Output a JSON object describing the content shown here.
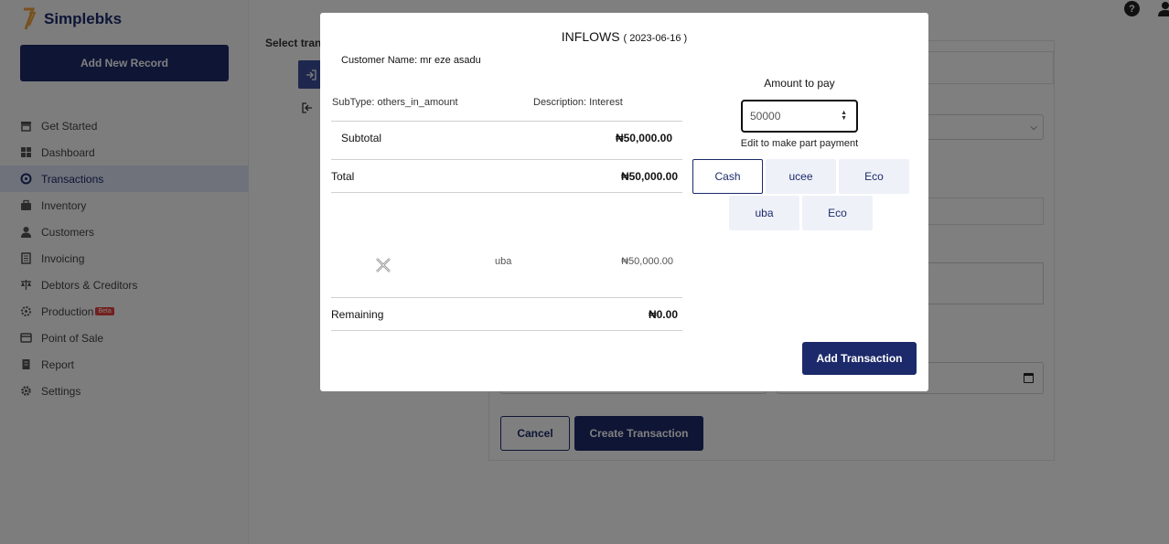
{
  "brand": {
    "name": "Simplebks"
  },
  "sidebar": {
    "add_record_label": "Add New Record",
    "items": [
      {
        "label": "Get Started",
        "icon": "store-icon"
      },
      {
        "label": "Dashboard",
        "icon": "dashboard-icon"
      },
      {
        "label": "Transactions",
        "icon": "transactions-icon",
        "active": true
      },
      {
        "label": "Inventory",
        "icon": "briefcase-icon"
      },
      {
        "label": "Customers",
        "icon": "user-icon"
      },
      {
        "label": "Invoicing",
        "icon": "invoice-icon"
      },
      {
        "label": "Debtors & Creditors",
        "icon": "scale-icon"
      },
      {
        "label": "Production",
        "icon": "production-icon",
        "badge": "Beta"
      },
      {
        "label": "Point of Sale",
        "icon": "pos-icon"
      },
      {
        "label": "Report",
        "icon": "report-icon"
      },
      {
        "label": "Settings",
        "icon": "gear-icon"
      }
    ]
  },
  "background_form": {
    "select_label": "Select tran",
    "cancel_label": "Cancel",
    "create_label": "Create Transaction"
  },
  "topbar": {
    "help_glyph": "?"
  },
  "modal": {
    "title": "INFLOWS",
    "date": "( 2023-06-16 )",
    "customer_key": "Customer Name:",
    "customer_value": "mr eze asadu",
    "subtype_key": "SubType:",
    "subtype_value": "others_in_amount",
    "description_key": "Description:",
    "description_value": "Interest",
    "subtotal_label": "Subtotal",
    "subtotal_value": "₦50,000.00",
    "total_label": "Total",
    "total_value": "₦50,000.00",
    "payment": {
      "account": "uba",
      "amount": "₦50,000.00"
    },
    "remaining_label": "Remaining",
    "remaining_value": "₦0.00",
    "amount_label": "Amount to pay",
    "amount_value": "50000",
    "amount_hint": "Edit to make part payment",
    "accounts": [
      "Cash",
      "ucee",
      "Eco",
      "uba",
      "Eco"
    ],
    "selected_account": "Cash",
    "add_transaction_label": "Add Transaction"
  },
  "colors": {
    "primary": "#1c2a6b",
    "active_nav_bg": "#dfe4f4",
    "beta_badge": "#e8413d"
  }
}
